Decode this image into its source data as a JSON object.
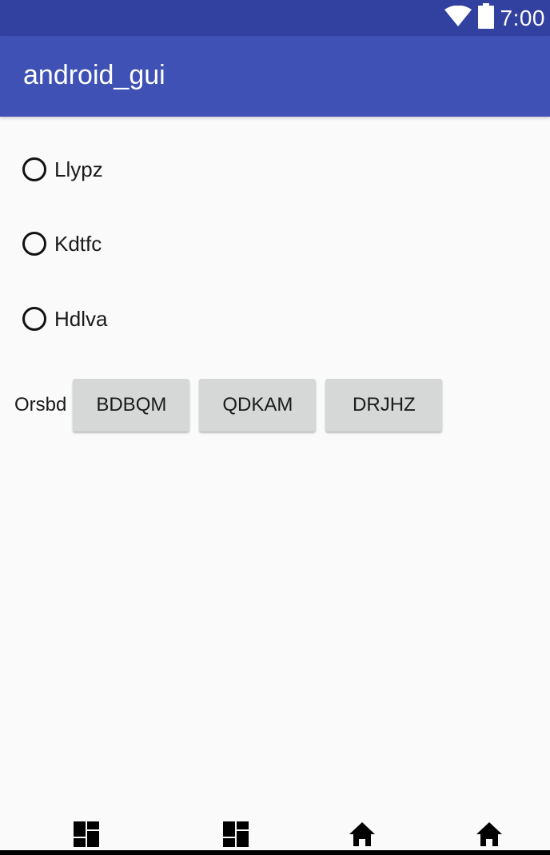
{
  "status_bar": {
    "time": "7:00",
    "icons": [
      "wifi-icon",
      "battery-icon"
    ],
    "color": "#3241a0"
  },
  "app_bar": {
    "title": "android_gui",
    "color": "#3f51b5"
  },
  "radio_options": [
    {
      "label": "Llypz",
      "checked": false
    },
    {
      "label": "Kdtfc",
      "checked": false
    },
    {
      "label": "Hdlva",
      "checked": false
    }
  ],
  "button_group": {
    "label": "Orsbd",
    "buttons": [
      {
        "label": "BDBQM"
      },
      {
        "label": "QDKAM"
      },
      {
        "label": "DRJHZ"
      }
    ]
  },
  "nav_bar": {
    "icons": [
      "dashboard-icon",
      "dashboard-icon",
      "home-icon",
      "home-icon"
    ]
  }
}
